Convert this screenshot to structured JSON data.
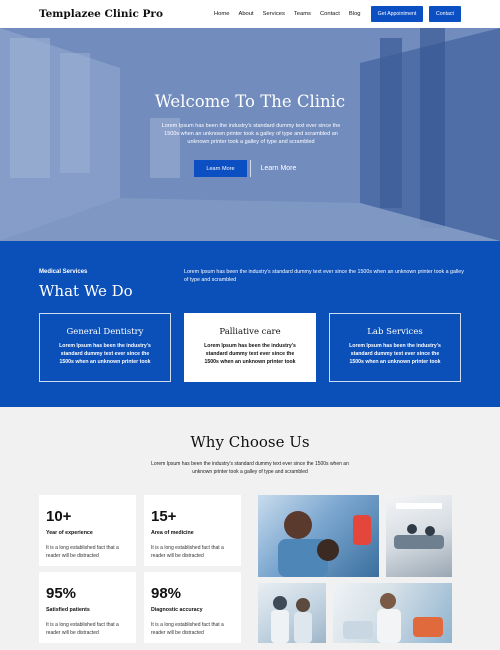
{
  "nav": {
    "brand": "Templazee Clinic Pro",
    "menu": [
      "Home",
      "About",
      "Services",
      "Teams",
      "Contact",
      "Blog"
    ],
    "appointment_label": "Get Appointment",
    "contact_label": "Contact"
  },
  "hero": {
    "title": "Welcome To The Clinic",
    "subtitle": "Lorem Ipsum has been the industry's standard dummy text ever since the 1500s when an unknown printer took a galley of type and scrambled an unknown printer took a galley of type and scrambled",
    "primary_label": "Learn More",
    "secondary_label": "Learn More"
  },
  "services": {
    "kicker": "Medical Services",
    "title": "What We Do",
    "description": "Lorem Ipsum has been the industry's standard dummy text ever since the 1500s when an unknown printer took a galley of type and scrambled",
    "cards": [
      {
        "title": "General Dentistry",
        "text": "Lorem Ipsum has been the industry's standard dummy text ever since the 1500s when an unknown printer took"
      },
      {
        "title": "Palliative care",
        "text": "Lorem Ipsum has been the industry's standard dummy text ever since the 1500s when an unknown printer took"
      },
      {
        "title": "Lab Services",
        "text": "Lorem Ipsum has been the industry's standard dummy text ever since the 1500s when an unknown printer took"
      }
    ]
  },
  "why": {
    "title": "Why Choose Us",
    "subtitle": "Lorem Ipsum has been the industry's standard dummy text ever since the 1500s when an unknown printer took a galley of type and scrambled",
    "stats": [
      {
        "num": "10+",
        "label": "Year of experience",
        "text": "It is a long established fact that a reader will be distracted"
      },
      {
        "num": "15+",
        "label": "Area of medicine",
        "text": "It is a long established fact that a reader will be distracted"
      },
      {
        "num": "95%",
        "label": "Satisfied patients",
        "text": "It is a long established fact that a reader will be distracted"
      },
      {
        "num": "98%",
        "label": "Diagnostic accuracy",
        "text": "It is a long established fact that a reader will be distracted"
      }
    ]
  },
  "colors": {
    "primary": "#0b4fc2",
    "services_bg": "#0b4fb8",
    "why_bg": "#f1f1f1"
  }
}
